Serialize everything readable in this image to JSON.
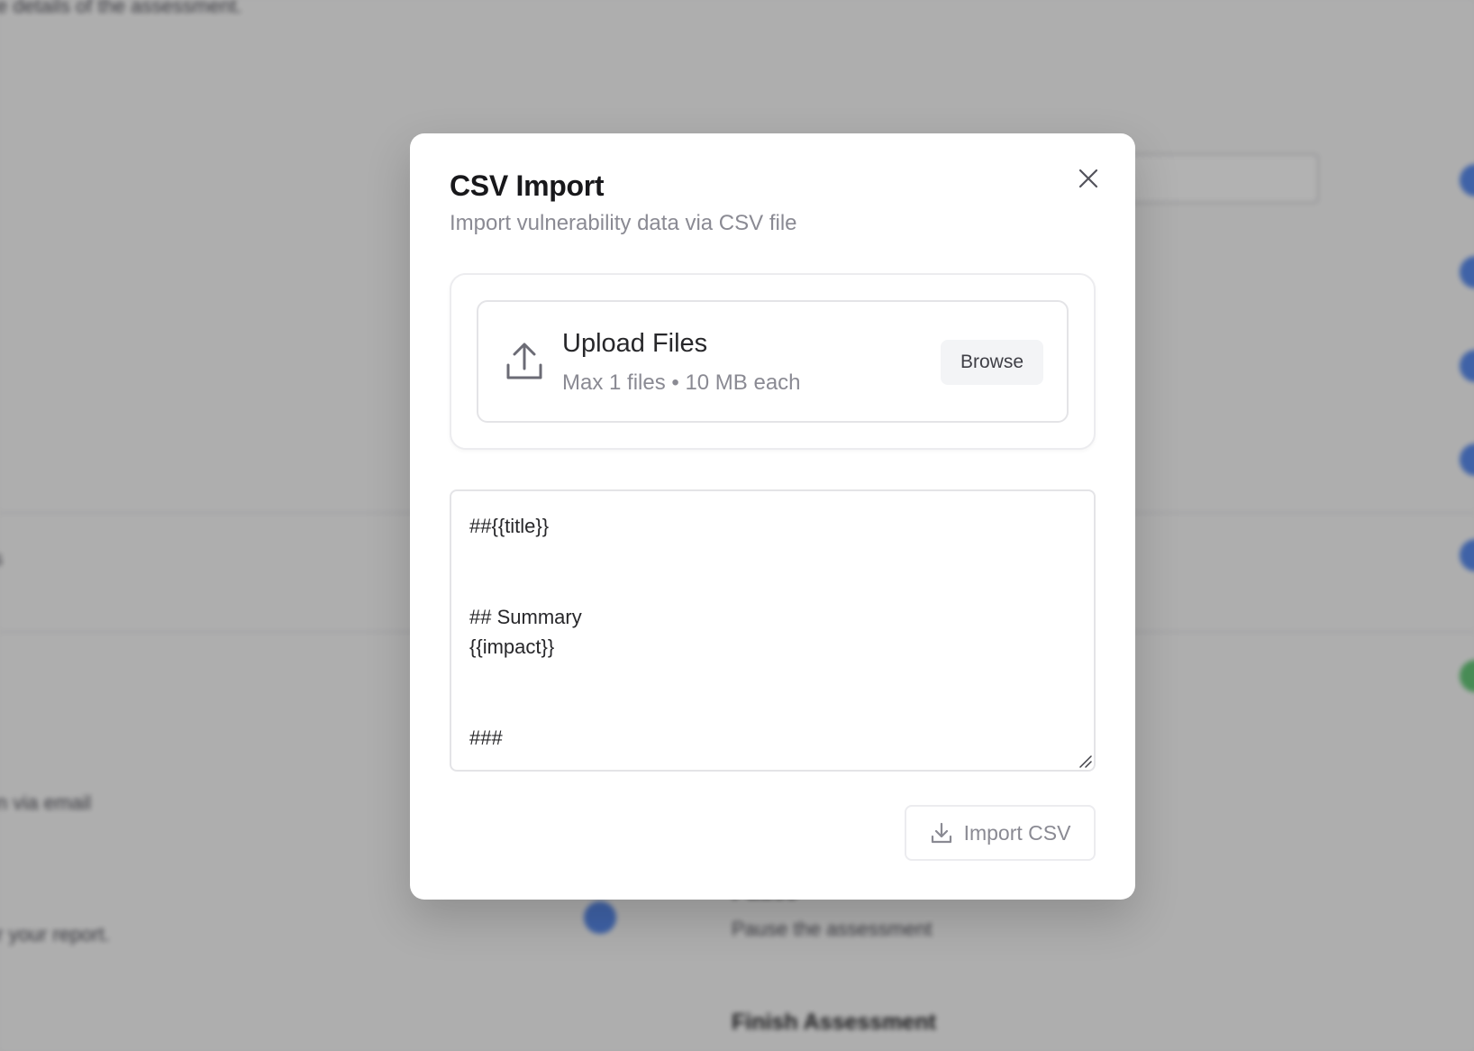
{
  "background": {
    "top_text": "e details of the assessment.",
    "email_text": "n via email",
    "report_text": "r your report.",
    "side_title": "Pause",
    "side_desc": "Pause the assessment",
    "finish_title": "Finish Assessment"
  },
  "modal": {
    "title": "CSV Import",
    "subtitle": "Import vulnerability data via CSV file",
    "close_icon": "close-icon",
    "upload": {
      "icon": "upload-icon",
      "title": "Upload Files",
      "meta": "Max 1 files • 10 MB each",
      "browse_label": "Browse"
    },
    "template": {
      "value": "##{{title}}\n\n\n## Summary\n{{impact}}\n\n\n###"
    },
    "import_button": {
      "icon": "download-icon",
      "label": "Import CSV"
    }
  },
  "colors": {
    "overlay": "#000000",
    "modal_bg": "#ffffff",
    "muted_text": "#8a8a93",
    "accent_blue": "#5b8def",
    "accent_green": "#67c87a"
  }
}
